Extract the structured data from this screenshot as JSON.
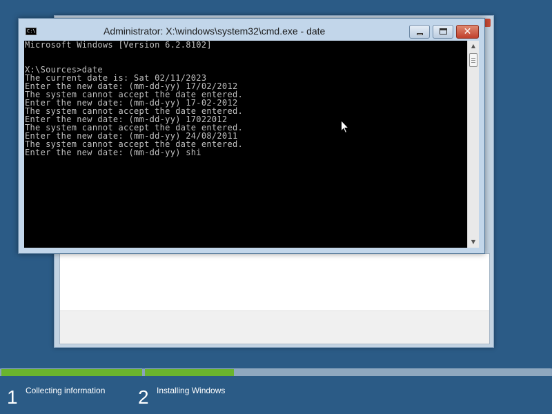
{
  "setup_window": {
    "close_color": "#c84a36"
  },
  "cmd": {
    "title": "Administrator: X:\\windows\\system32\\cmd.exe - date",
    "icon_text": "C:\\",
    "close_glyph": "✕",
    "lines": [
      "Microsoft Windows [Version 6.2.8102]",
      "",
      "",
      "X:\\Sources>date",
      "The current date is: Sat 02/11/2023",
      "Enter the new date: (mm-dd-yy) 17/02/2012",
      "The system cannot accept the date entered.",
      "Enter the new date: (mm-dd-yy) 17-02-2012",
      "The system cannot accept the date entered.",
      "Enter the new date: (mm-dd-yy) 17022012",
      "The system cannot accept the date entered.",
      "Enter the new date: (mm-dd-yy) 24/08/2011",
      "The system cannot accept the date entered.",
      "Enter the new date: (mm-dd-yy) shi"
    ],
    "scroll_up_glyph": "▲",
    "scroll_down_glyph": "▼"
  },
  "setup_progress": {
    "accent_color": "#6ab42e",
    "steps": [
      {
        "number": "1",
        "label": "Collecting information",
        "progress": 1.0
      },
      {
        "number": "2",
        "label": "Installing Windows",
        "progress": 0.22
      }
    ]
  }
}
